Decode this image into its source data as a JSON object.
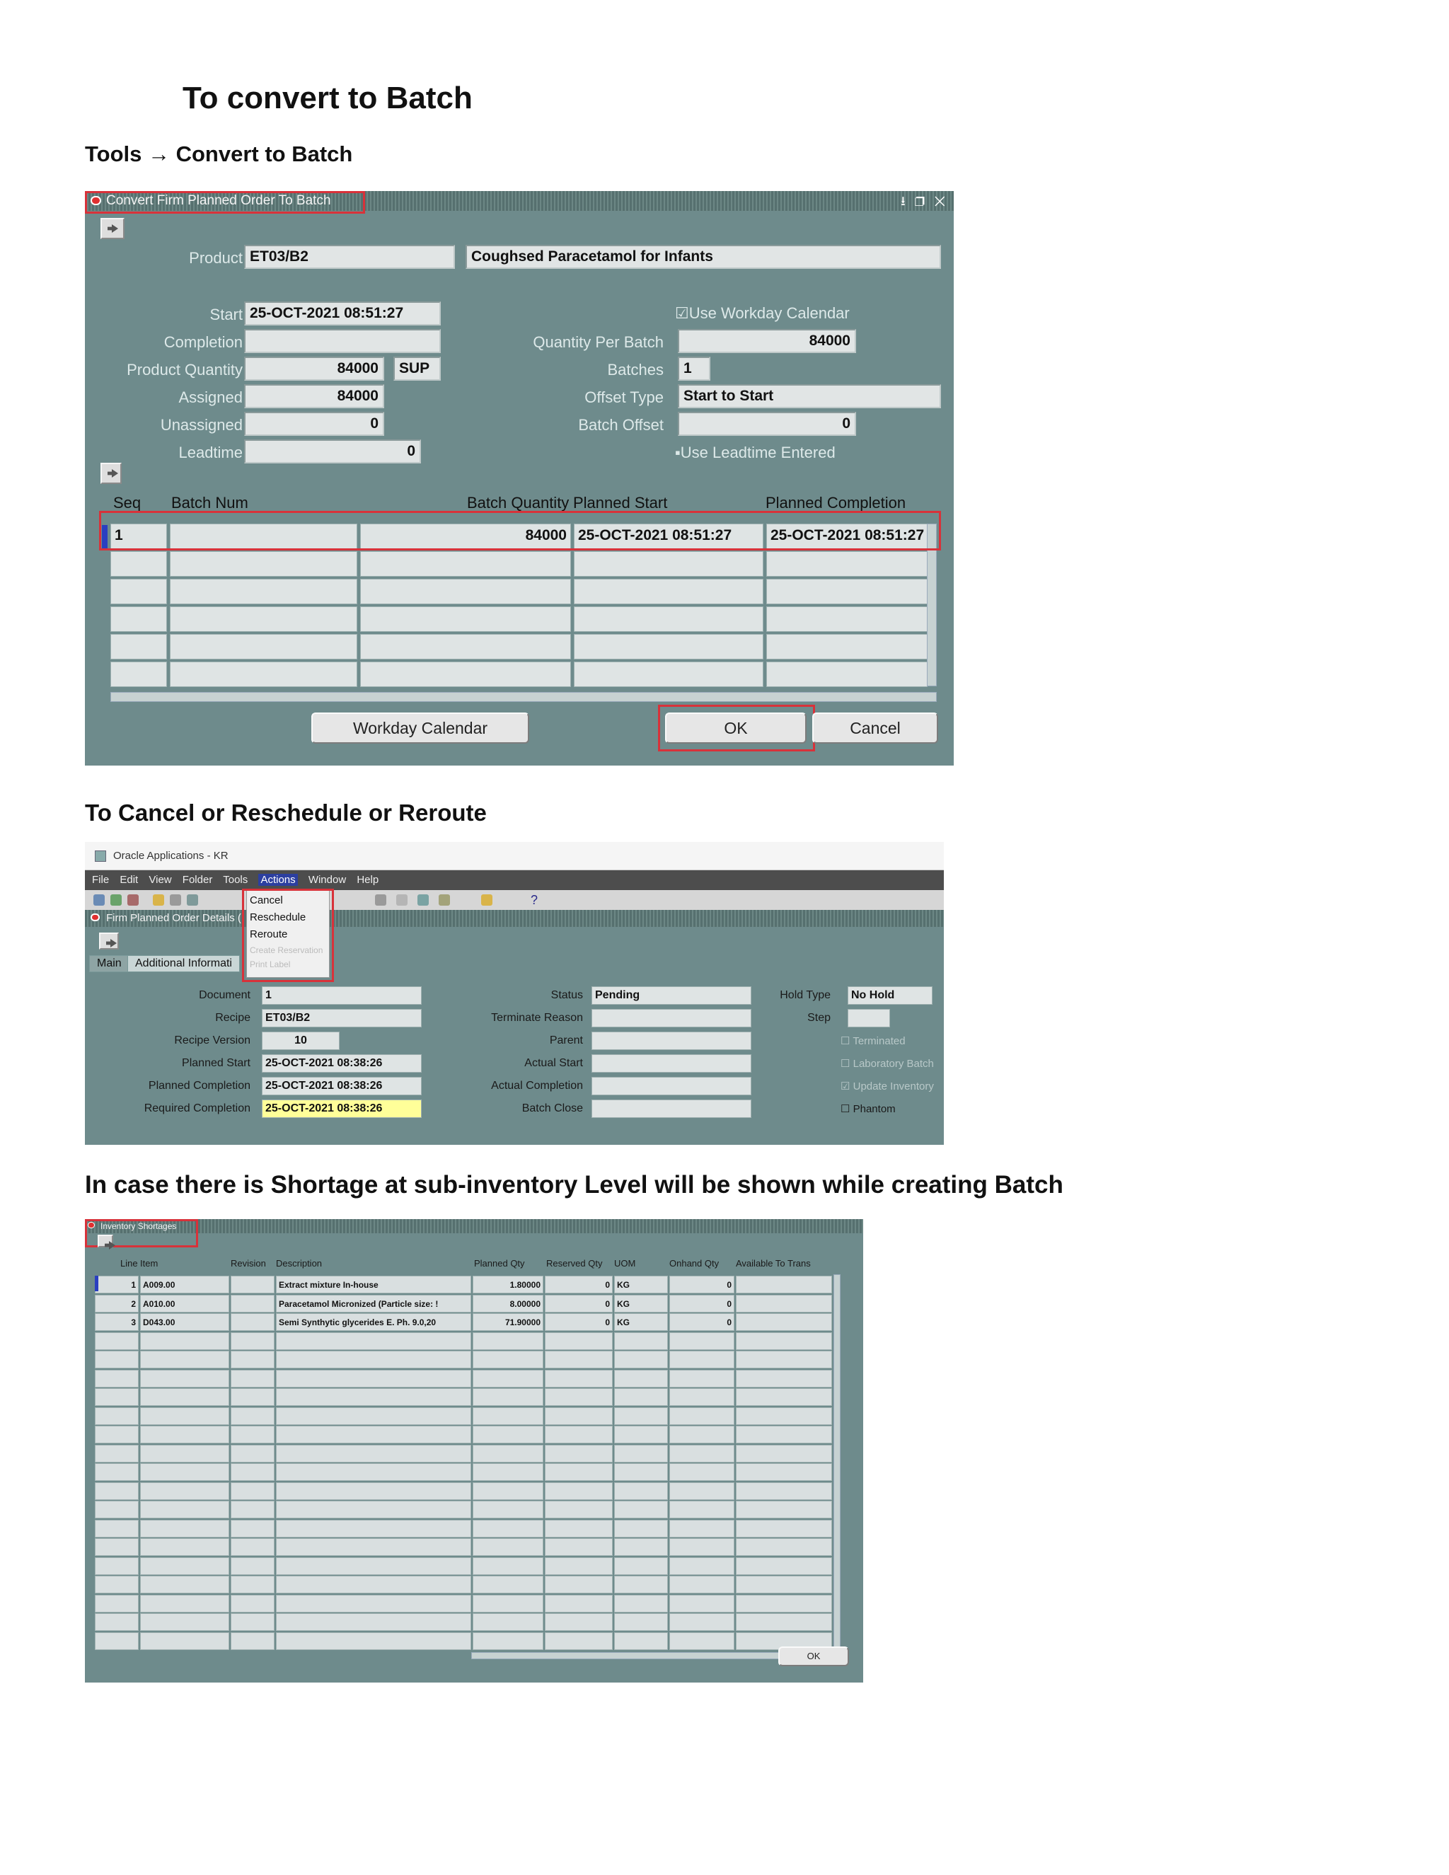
{
  "headings": {
    "main": "To convert to Batch",
    "tools": "Tools → Convert to Batch",
    "cancel": "To Cancel or Reschedule or Reroute",
    "shortage": "In case there is Shortage at sub-inventory Level will be shown while creating Batch"
  },
  "convert_window": {
    "title": "Convert Firm Planned Order To Batch",
    "controls": "⭳ ❐ ✕",
    "labels": {
      "product": "Product",
      "start": "Start",
      "completion": "Completion",
      "product_quantity": "Product Quantity",
      "assigned": "Assigned",
      "unassigned": "Unassigned",
      "leadtime": "Leadtime",
      "quantity_per_batch": "Quantity Per Batch",
      "batches": "Batches",
      "offset_type": "Offset Type",
      "batch_offset": "Batch Offset"
    },
    "values": {
      "product_code": "ET03/B2",
      "product_desc": "Coughsed Paracetamol for Infants",
      "start": "25-OCT-2021 08:51:27",
      "completion": "",
      "product_quantity": "84000",
      "uom": "SUP",
      "assigned": "84000",
      "unassigned": "0",
      "leadtime": "0",
      "quantity_per_batch": "84000",
      "batches": "1",
      "offset_type": "Start to Start",
      "batch_offset": "0"
    },
    "checkboxes": {
      "workday": "☑Use Workday Calendar",
      "leadtime": "▪Use Leadtime Entered"
    },
    "table_headers": [
      "Seq",
      "Batch Num",
      "Batch Quantity",
      "Planned Start",
      "Planned Completion"
    ],
    "rows": [
      [
        "1",
        "",
        "84000",
        "25-OCT-2021 08:51:27",
        "25-OCT-2021 08:51:27"
      ],
      [
        "",
        "",
        "",
        "",
        ""
      ],
      [
        "",
        "",
        "",
        "",
        ""
      ],
      [
        "",
        "",
        "",
        "",
        ""
      ],
      [
        "",
        "",
        "",
        "",
        ""
      ],
      [
        "",
        "",
        "",
        "",
        ""
      ]
    ],
    "buttons": {
      "workday": "Workday Calendar",
      "ok": "OK",
      "cancel": "Cancel"
    }
  },
  "details_window": {
    "app_title": "Oracle Applications - KR",
    "menu": [
      "File",
      "Edit",
      "View",
      "Folder",
      "Tools",
      "Actions",
      "Window",
      "Help"
    ],
    "actions_menu": [
      "Cancel",
      "Reschedule",
      "Reroute",
      "Create Reservation",
      "Print Label"
    ],
    "title": "Firm Planned Order Details (",
    "tabs": [
      "Main",
      "Additional Informati"
    ],
    "labels_left": [
      "Document",
      "Recipe",
      "Recipe Version",
      "Planned Start",
      "Planned Completion",
      "Required Completion"
    ],
    "values_left": [
      "1",
      "ET03/B2",
      "10",
      "25-OCT-2021 08:38:26",
      "25-OCT-2021 08:38:26",
      "25-OCT-2021 08:38:26"
    ],
    "labels_mid": [
      "Status",
      "Terminate Reason",
      "Parent",
      "Actual Start",
      "Actual Completion",
      "Batch Close"
    ],
    "values_mid": [
      "Pending",
      "",
      "",
      "",
      "",
      ""
    ],
    "hold_type_label": "Hold Type",
    "hold_type_value": "No Hold",
    "step_label": "Step",
    "checks": [
      "☐ Terminated",
      "☐ Laboratory Batch",
      "☑ Update Inventory",
      "☐ Phantom"
    ]
  },
  "shortage_window": {
    "title": "Inventory Shortages",
    "headers": [
      "Line",
      "Item",
      "Revision",
      "Description",
      "Planned Qty",
      "Reserved Qty",
      "UOM",
      "Onhand Qty",
      "Available To Trans"
    ],
    "rows": [
      [
        "1",
        "A009.00",
        "",
        "Extract mixture In-house",
        "1.80000",
        "0",
        "KG",
        "0",
        ""
      ],
      [
        "2",
        "A010.00",
        "",
        "Paracetamol Micronized (Particle size: !",
        "8.00000",
        "0",
        "KG",
        "0",
        ""
      ],
      [
        "3",
        "D043.00",
        "",
        "Semi Synthytic glycerides E. Ph. 9.0,20",
        "71.90000",
        "0",
        "KG",
        "0",
        ""
      ]
    ],
    "ok": "OK"
  }
}
